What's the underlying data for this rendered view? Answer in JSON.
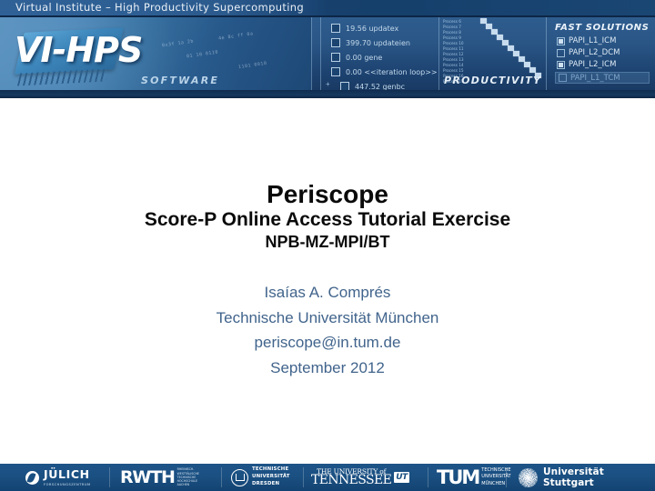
{
  "header": {
    "strip_title": "Virtual Institute – High Productivity Supercomputing",
    "logo_text": "VI-HPS",
    "software_label": "SOFTWARE",
    "productivity_label": "PRODUCTIVITY",
    "fast_solutions_label": "FAST SOLUTIONS",
    "checkbox_items": [
      {
        "label": "19.56 updatex",
        "checked": false,
        "indent": false
      },
      {
        "label": "399.70 updateien",
        "checked": false,
        "indent": false
      },
      {
        "label": "0.00 gene",
        "checked": false,
        "indent": false
      },
      {
        "label": "0.00 <<iteration loop>>",
        "checked": false,
        "indent": false
      },
      {
        "label": "447.52 genbc",
        "checked": false,
        "indent": true
      }
    ],
    "papi_items": [
      {
        "label": "PAPI_L1_ICM",
        "checked": true
      },
      {
        "label": "PAPI_L2_DCM",
        "checked": false
      },
      {
        "label": "PAPI_L2_ICM",
        "checked": true
      }
    ],
    "papi_disabled": {
      "label": "PAPI_L1_TCM",
      "checked": false
    },
    "process_labels": [
      "Process 6",
      "Process 7",
      "Process 8",
      "Process 9",
      "Process 10",
      "Process 11",
      "Process 12",
      "Process 13",
      "Process 14",
      "Process 15",
      "Process 16",
      "Process 17"
    ],
    "code_wisps": [
      "0x3f 1a 2b",
      "01 10 0110",
      "4e 8c ff 0a",
      "1101 0010"
    ],
    "colors": {
      "band_dark": "#14355f",
      "band_mid": "#2a5686",
      "panel_light": "#5d94bf",
      "text_light": "#e9eff6"
    }
  },
  "slide": {
    "title": "Periscope",
    "subtitle_1": "Score-P Online Access Tutorial Exercise",
    "subtitle_2": "NPB-MZ-MPI/BT",
    "info_lines": [
      "Isaías A. Comprés",
      "Technische Universität München",
      "periscope@in.tum.de",
      "September 2012"
    ],
    "colors": {
      "title": "#0a0a0a",
      "info": "#41648c",
      "background": "#ffffff"
    }
  },
  "footer": {
    "background": "#1a4f81",
    "logos": [
      {
        "name": "Forschungszentrum Jülich",
        "primary": "JÜLICH",
        "secondary": "FORSCHUNGSZENTRUM"
      },
      {
        "name": "RWTH Aachen",
        "primary": "RWTH",
        "secondary": "RHEINISCH-\nWESTFÄLISCHE\nTECHNISCHE\nHOCHSCHULE\nAACHEN"
      },
      {
        "name": "TU Dresden",
        "primary": "",
        "secondary": "TECHNISCHE\nUNIVERSITÄT\nDRESDEN"
      },
      {
        "name": "University of Tennessee",
        "primary": "TENNESSEE",
        "secondary": "THE UNIVERSITY of",
        "badge": "UT"
      },
      {
        "name": "TU München",
        "primary": "TUM",
        "secondary": "TECHNISCHE\nUNIVERSITÄT\nMÜNCHEN"
      },
      {
        "name": "Universität Stuttgart",
        "primary": "Universität Stuttgart",
        "secondary": ""
      }
    ]
  }
}
